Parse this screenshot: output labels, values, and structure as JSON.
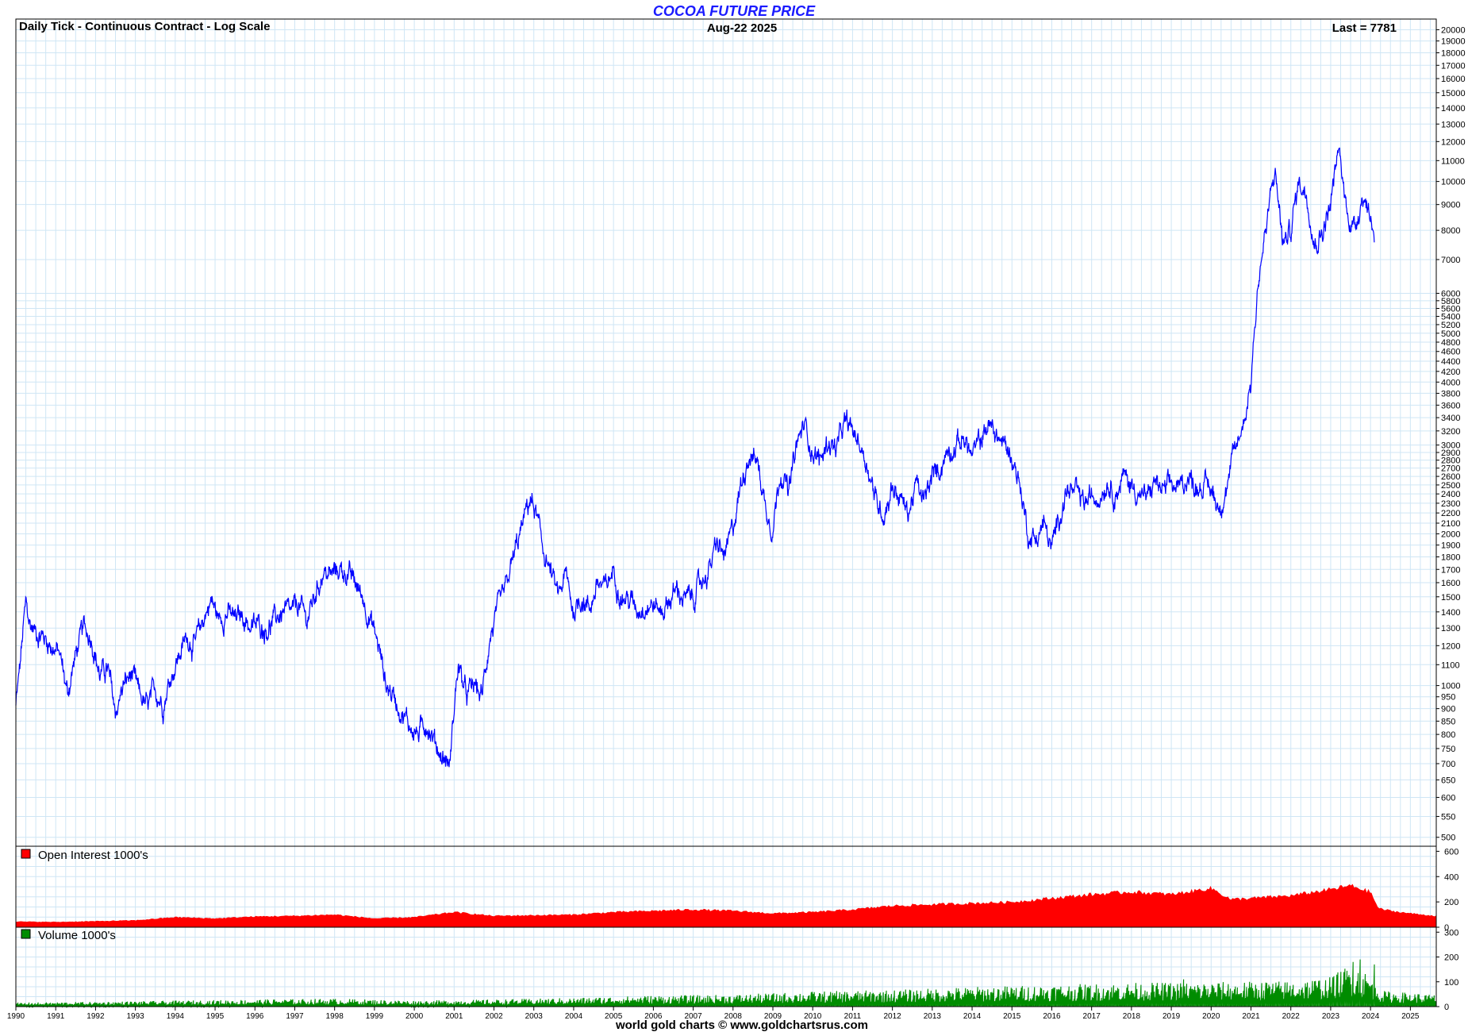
{
  "header": {
    "title": "COCOA FUTURE PRICE",
    "subtitle_left": "Daily Tick - Continuous Contract - Log Scale",
    "date": "Aug-22  2025",
    "last": "Last = 7781"
  },
  "footer": {
    "credit": "world gold charts © www.goldchartsrus.com"
  },
  "colors": {
    "price": "#0000ff",
    "open_interest": "#ff0000",
    "volume": "#008c00",
    "grid": "#cfe6f5",
    "title": "#1a1aff"
  },
  "chart_data": [
    {
      "type": "line",
      "name": "price",
      "yscale": "log",
      "ylim": [
        480,
        21000
      ],
      "xlim": [
        1990.0,
        2025.65
      ],
      "grid": true,
      "y_ticks": [
        500,
        550,
        600,
        650,
        700,
        750,
        800,
        850,
        900,
        950,
        1000,
        1100,
        1200,
        1300,
        1400,
        1500,
        1600,
        1700,
        1800,
        1900,
        2000,
        2100,
        2200,
        2300,
        2400,
        2500,
        2600,
        2700,
        2800,
        2900,
        3000,
        3200,
        3400,
        3600,
        3800,
        4000,
        4200,
        4400,
        4600,
        4800,
        5000,
        5200,
        5400,
        5600,
        5800,
        6000,
        7000,
        8000,
        9000,
        10000,
        11000,
        12000,
        13000,
        14000,
        15000,
        16000,
        17000,
        18000,
        19000,
        20000
      ],
      "x": [
        1990.0,
        1990.1,
        1990.25,
        1990.35,
        1990.5,
        1990.7,
        1990.9,
        1991.1,
        1991.3,
        1991.5,
        1991.7,
        1991.9,
        1992.1,
        1992.3,
        1992.5,
        1992.7,
        1992.9,
        1993.1,
        1993.3,
        1993.5,
        1993.7,
        1993.9,
        1994.1,
        1994.3,
        1994.5,
        1994.7,
        1994.9,
        1995.1,
        1995.3,
        1995.5,
        1995.7,
        1995.9,
        1996.1,
        1996.3,
        1996.5,
        1996.7,
        1996.9,
        1997.1,
        1997.3,
        1997.5,
        1997.7,
        1997.9,
        1998.1,
        1998.3,
        1998.5,
        1998.7,
        1998.9,
        1999.1,
        1999.3,
        1999.5,
        1999.7,
        1999.9,
        2000.1,
        2000.3,
        2000.5,
        2000.7,
        2000.9,
        2001.1,
        2001.3,
        2001.5,
        2001.7,
        2001.9,
        2002.1,
        2002.3,
        2002.5,
        2002.7,
        2002.9,
        2003.05,
        2003.2,
        2003.4,
        2003.6,
        2003.8,
        2004.0,
        2004.2,
        2004.4,
        2004.6,
        2004.8,
        2005.0,
        2005.2,
        2005.4,
        2005.6,
        2005.8,
        2006.0,
        2006.2,
        2006.4,
        2006.6,
        2006.8,
        2007.0,
        2007.2,
        2007.4,
        2007.6,
        2007.8,
        2008.0,
        2008.2,
        2008.4,
        2008.6,
        2008.8,
        2009.0,
        2009.2,
        2009.4,
        2009.6,
        2009.8,
        2010.0,
        2010.2,
        2010.4,
        2010.6,
        2010.8,
        2011.0,
        2011.2,
        2011.4,
        2011.6,
        2011.8,
        2012.0,
        2012.2,
        2012.4,
        2012.6,
        2012.8,
        2013.0,
        2013.2,
        2013.4,
        2013.6,
        2013.8,
        2014.0,
        2014.2,
        2014.4,
        2014.6,
        2014.8,
        2015.0,
        2015.2,
        2015.4,
        2015.6,
        2015.8,
        2016.0,
        2016.2,
        2016.4,
        2016.6,
        2016.8,
        2017.0,
        2017.2,
        2017.4,
        2017.6,
        2017.8,
        2018.0,
        2018.2,
        2018.4,
        2018.6,
        2018.8,
        2019.0,
        2019.2,
        2019.4,
        2019.6,
        2019.8,
        2020.0,
        2020.2,
        2020.4,
        2020.6,
        2020.8,
        2021.0,
        2021.2,
        2021.4,
        2021.6,
        2021.8,
        2022.0,
        2022.2,
        2022.4,
        2022.6,
        2022.8,
        2023.0,
        2023.2,
        2023.4,
        2023.6,
        2023.8,
        2024.0,
        2024.1,
        2024.2,
        2024.3,
        2024.4,
        2024.5,
        2024.6,
        2024.7,
        2024.8,
        2024.9,
        2025.0,
        2025.1,
        2025.2,
        2025.3,
        2025.4,
        2025.5,
        2025.64
      ],
      "y": [
        910,
        1080,
        1450,
        1320,
        1280,
        1250,
        1200,
        1150,
        960,
        1150,
        1300,
        1250,
        1050,
        1080,
        880,
        1000,
        1050,
        960,
        900,
        980,
        920,
        1050,
        1150,
        1250,
        1200,
        1350,
        1480,
        1350,
        1400,
        1350,
        1380,
        1300,
        1320,
        1300,
        1350,
        1400,
        1380,
        1450,
        1350,
        1500,
        1680,
        1650,
        1700,
        1680,
        1600,
        1500,
        1350,
        1200,
        1000,
        950,
        880,
        830,
        800,
        850,
        780,
        720,
        700,
        1100,
        950,
        1000,
        950,
        1250,
        1400,
        1550,
        1800,
        2050,
        2350,
        2200,
        1900,
        1700,
        1500,
        1650,
        1400,
        1500,
        1420,
        1600,
        1550,
        1700,
        1500,
        1480,
        1420,
        1450,
        1450,
        1400,
        1480,
        1550,
        1480,
        1500,
        1600,
        1700,
        1900,
        1800,
        2050,
        2500,
        2900,
        2800,
        2300,
        2050,
        2700,
        2400,
        3000,
        3300,
        2900,
        2800,
        3050,
        2950,
        3300,
        3200,
        3000,
        2700,
        2300,
        2200,
        2500,
        2350,
        2200,
        2500,
        2300,
        2600,
        2700,
        2950,
        3000,
        3100,
        2850,
        3050,
        3300,
        3150,
        3000,
        2850,
        2500,
        2000,
        1950,
        2100,
        1850,
        2200,
        2450,
        2400,
        2300,
        2350,
        2400,
        2550,
        2400,
        2600,
        2500,
        2400,
        2350,
        2550,
        2400,
        2500,
        2450,
        2600,
        2500,
        2500,
        2450,
        2250,
        2500,
        2900,
        3300,
        4000,
        6500,
        8200,
        10500,
        7500,
        8000,
        10000,
        9500,
        7500,
        8000,
        9000,
        11500,
        8800,
        8000,
        9500,
        8500,
        7781
      ],
      "last": 7781
    },
    {
      "type": "area",
      "name": "Open Interest 1000's",
      "ylim": [
        0,
        640
      ],
      "y_ticks": [
        0,
        200,
        400,
        600
      ],
      "x": [
        1990.0,
        1991.0,
        1992.0,
        1993.0,
        1994.0,
        1995.0,
        1996.0,
        1997.0,
        1998.0,
        1999.0,
        2000.0,
        2001.0,
        2002.0,
        2003.0,
        2004.0,
        2005.0,
        2006.0,
        2007.0,
        2008.0,
        2009.0,
        2010.0,
        2011.0,
        2012.0,
        2013.0,
        2014.0,
        2015.0,
        2016.0,
        2017.0,
        2018.0,
        2019.0,
        2020.0,
        2020.5,
        2021.0,
        2022.0,
        2023.0,
        2023.5,
        2024.0,
        2024.2,
        2024.5,
        2025.0,
        2025.64
      ],
      "y": [
        45,
        42,
        48,
        55,
        80,
        70,
        85,
        90,
        100,
        70,
        80,
        120,
        90,
        95,
        100,
        120,
        130,
        140,
        130,
        110,
        120,
        140,
        170,
        180,
        190,
        200,
        230,
        260,
        280,
        260,
        310,
        220,
        230,
        250,
        300,
        330,
        280,
        150,
        130,
        110,
        90
      ]
    },
    {
      "type": "area",
      "name": "Volume 1000's",
      "ylim": [
        0,
        320
      ],
      "y_ticks": [
        0,
        100,
        200,
        300
      ],
      "x": [
        1990.0,
        1992.0,
        1994.0,
        1996.0,
        1998.0,
        2000.0,
        2002.0,
        2004.0,
        2006.0,
        2008.0,
        2010.0,
        2012.0,
        2014.0,
        2016.0,
        2018.0,
        2020.0,
        2022.0,
        2023.0,
        2023.5,
        2024.0,
        2024.3,
        2025.0,
        2025.64
      ],
      "y": [
        10,
        12,
        15,
        18,
        20,
        15,
        18,
        22,
        28,
        30,
        38,
        42,
        50,
        55,
        60,
        62,
        65,
        75,
        110,
        80,
        40,
        35,
        30
      ],
      "peaks": [
        [
          2023.55,
          180
        ],
        [
          2023.75,
          190
        ],
        [
          2024.1,
          170
        ],
        [
          2021.4,
          95
        ],
        [
          2019.3,
          110
        ]
      ]
    }
  ],
  "x_axis": {
    "labels": [
      "1990",
      "1991",
      "1992",
      "1993",
      "1994",
      "1995",
      "1996",
      "1997",
      "1998",
      "1999",
      "2000",
      "2001",
      "2002",
      "2003",
      "2004",
      "2005",
      "2006",
      "2007",
      "2008",
      "2009",
      "2010",
      "2011",
      "2012",
      "2013",
      "2014",
      "2015",
      "2016",
      "2017",
      "2018",
      "2019",
      "2020",
      "2021",
      "2022",
      "2023",
      "2024",
      "2025"
    ]
  }
}
